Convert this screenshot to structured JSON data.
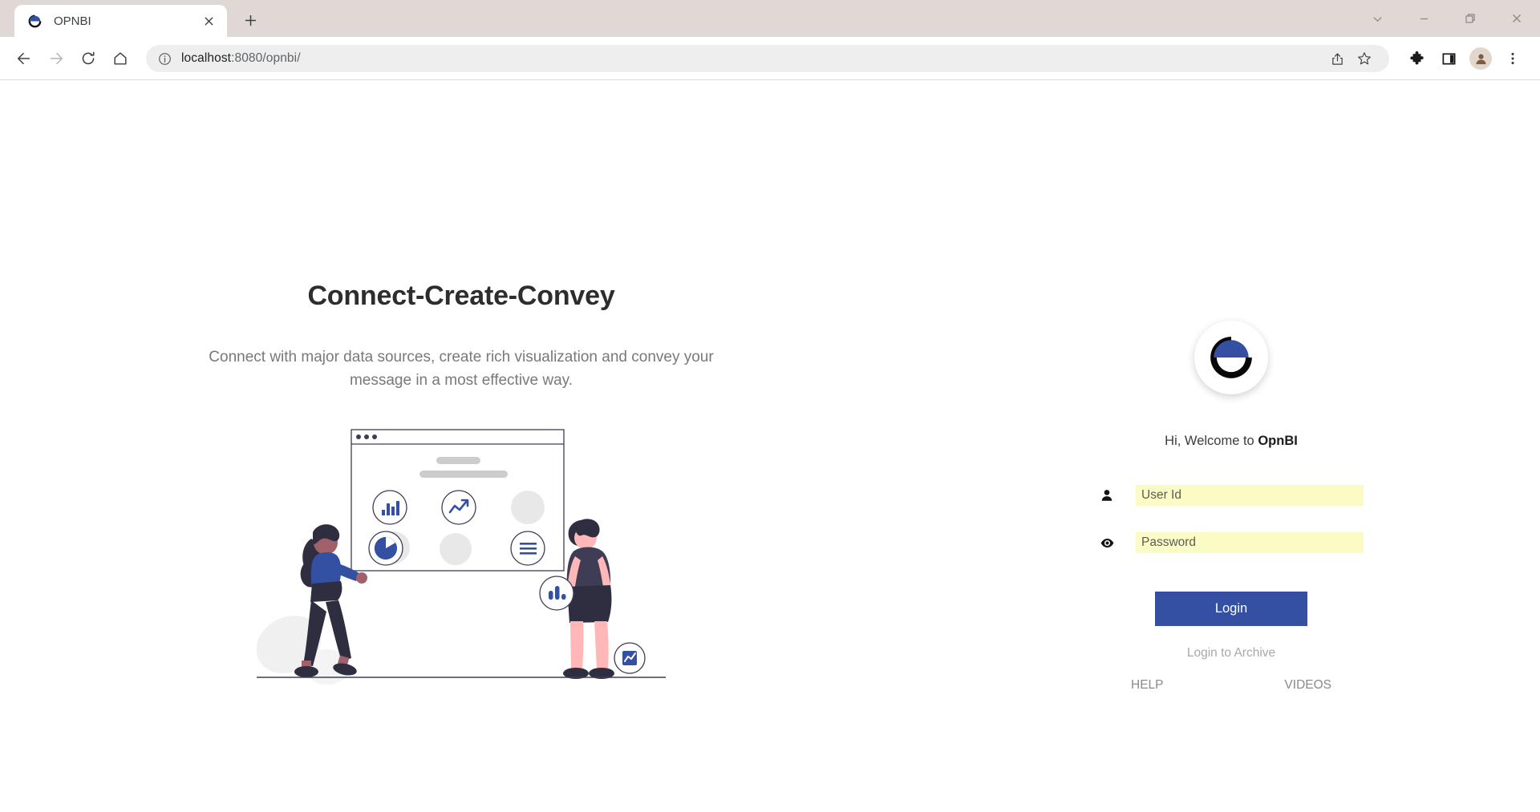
{
  "browser": {
    "tab": {
      "title": "OPNBI",
      "favicon_icon": "opnbi-donut-icon",
      "close_icon": "close-icon"
    },
    "new_tab_label": "+",
    "window_controls": [
      {
        "name": "tab-search",
        "icon": "chevron-down-icon"
      },
      {
        "name": "minimize",
        "icon": "minimize-icon"
      },
      {
        "name": "maximize",
        "icon": "restore-icon"
      },
      {
        "name": "close",
        "icon": "close-icon"
      }
    ],
    "nav": {
      "back_icon": "arrow-left-icon",
      "forward_icon": "arrow-right-icon",
      "reload_icon": "reload-icon",
      "home_icon": "home-icon"
    },
    "omnibox": {
      "info_icon": "info-circle-icon",
      "url_host": "localhost",
      "url_path": ":8080/opnbi/",
      "share_icon": "share-icon",
      "bookmark_icon": "star-icon"
    },
    "toolbar_right": {
      "extensions_icon": "puzzle-piece-icon",
      "side_panel_icon": "side-panel-icon",
      "profile_icon": "person-avatar-icon",
      "menu_icon": "three-dot-menu-icon"
    }
  },
  "hero": {
    "headline": "Connect-Create-Convey",
    "subhead": "Connect with major data sources, create rich visualization and convey your message in a most effective way."
  },
  "illustration": {
    "name": "data-visualization-illustration",
    "colors": {
      "blue": "#3350a3",
      "dark": "#2f2e41",
      "grey": "#e4e4e4",
      "skin_light": "#ffb7b7",
      "skin_dark": "#a0616a"
    },
    "chart_icons": [
      "bar-chart-icon",
      "trend-up-icon",
      "pie-chart-icon",
      "list-icon",
      "column-chart-icon",
      "area-chart-icon"
    ]
  },
  "login": {
    "logo_icon": "opnbi-donut-logo",
    "welcome_prefix": "Hi, Welcome to ",
    "welcome_brand": "OpnBI",
    "fields": [
      {
        "name": "user-id",
        "icon": "person-icon",
        "placeholder": "User Id",
        "value": ""
      },
      {
        "name": "password",
        "icon": "eye-icon",
        "placeholder": "Password",
        "value": ""
      }
    ],
    "submit_label": "Login",
    "archive_link_label": "Login to Archive",
    "help_label": "HELP",
    "videos_label": "VIDEOS",
    "accent_color": "#3350a3",
    "field_bg_color": "#fbfcc4"
  }
}
